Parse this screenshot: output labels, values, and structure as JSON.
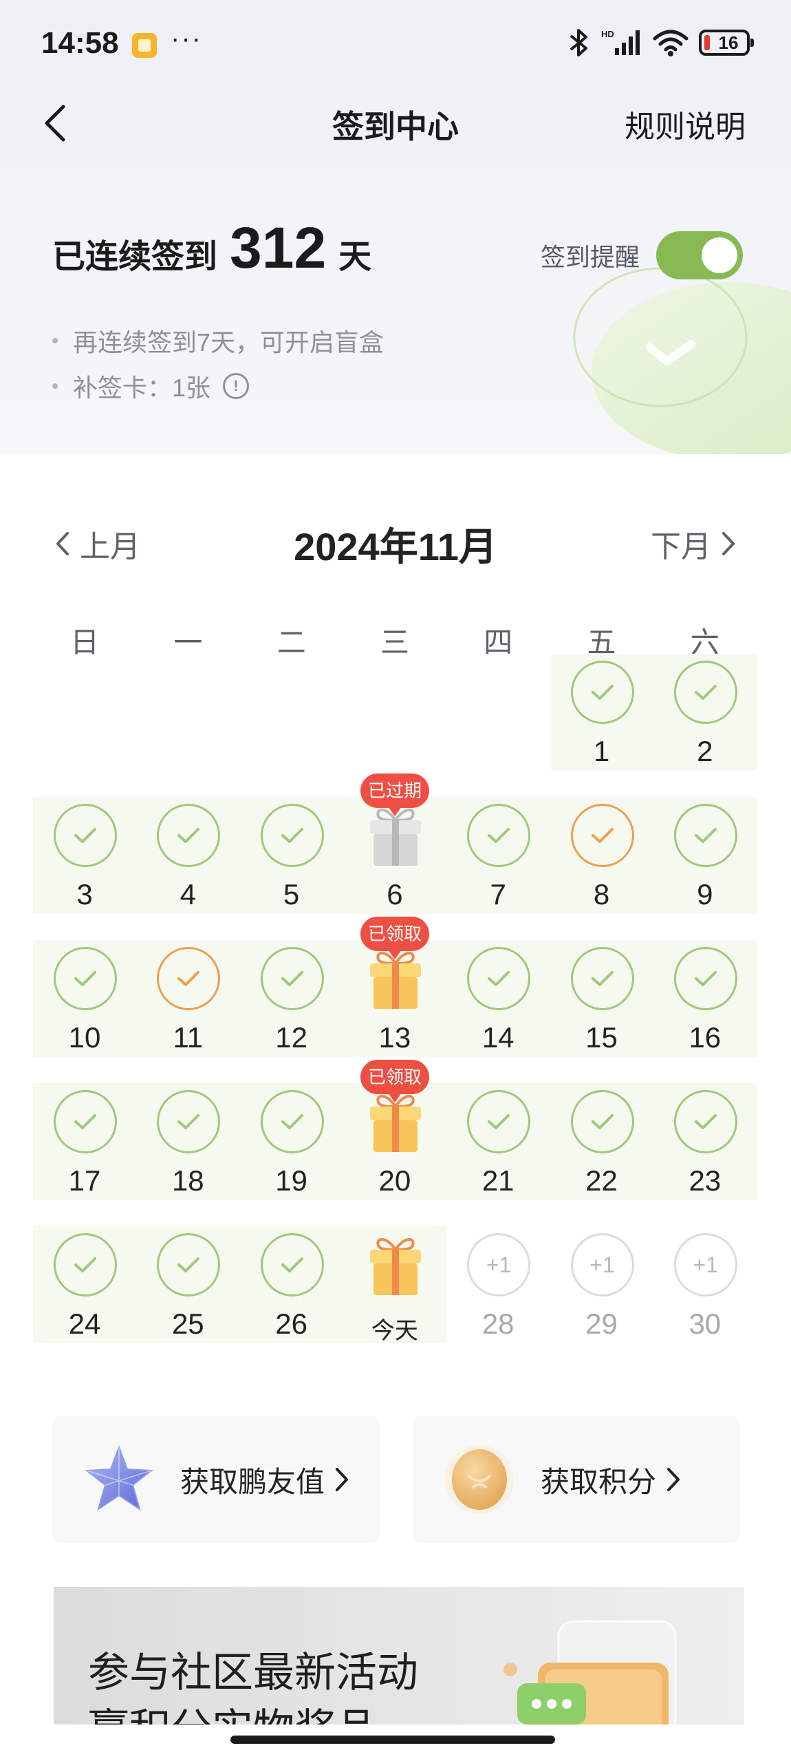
{
  "status_bar": {
    "time": "14:58",
    "more": "···",
    "network": "HD",
    "battery": "16"
  },
  "nav": {
    "title": "签到中心",
    "rules": "规则说明"
  },
  "streak": {
    "prefix": "已连续签到",
    "days": "312",
    "suffix": "天"
  },
  "reminder": {
    "label": "签到提醒",
    "enabled": true
  },
  "tips": [
    "再连续签到7天，可开启盲盒",
    "补签卡：1张"
  ],
  "calendar": {
    "prev": "上月",
    "next": "下月",
    "month_title": "2024年11月",
    "weekdays": [
      "日",
      "一",
      "二",
      "三",
      "四",
      "五",
      "六"
    ],
    "days": [
      {
        "label": "1",
        "status": "checked"
      },
      {
        "label": "2",
        "status": "checked"
      },
      {
        "label": "3",
        "status": "checked"
      },
      {
        "label": "4",
        "status": "checked"
      },
      {
        "label": "5",
        "status": "checked"
      },
      {
        "label": "6",
        "status": "gift-expired",
        "badge": "已过期"
      },
      {
        "label": "7",
        "status": "checked"
      },
      {
        "label": "8",
        "status": "makeup"
      },
      {
        "label": "9",
        "status": "checked"
      },
      {
        "label": "10",
        "status": "checked"
      },
      {
        "label": "11",
        "status": "makeup"
      },
      {
        "label": "12",
        "status": "checked"
      },
      {
        "label": "13",
        "status": "gift-claimed",
        "badge": "已领取"
      },
      {
        "label": "14",
        "status": "checked"
      },
      {
        "label": "15",
        "status": "checked"
      },
      {
        "label": "16",
        "status": "checked"
      },
      {
        "label": "17",
        "status": "checked"
      },
      {
        "label": "18",
        "status": "checked"
      },
      {
        "label": "19",
        "status": "checked"
      },
      {
        "label": "20",
        "status": "gift-claimed",
        "badge": "已领取"
      },
      {
        "label": "21",
        "status": "checked"
      },
      {
        "label": "22",
        "status": "checked"
      },
      {
        "label": "23",
        "status": "checked"
      },
      {
        "label": "24",
        "status": "checked"
      },
      {
        "label": "25",
        "status": "checked"
      },
      {
        "label": "26",
        "status": "checked"
      },
      {
        "label": "今天",
        "status": "gift-today"
      },
      {
        "label": "28",
        "status": "future",
        "reward": "+1"
      },
      {
        "label": "29",
        "status": "future",
        "reward": "+1"
      },
      {
        "label": "30",
        "status": "future",
        "reward": "+1"
      }
    ]
  },
  "cards": [
    {
      "label": "获取鹏友值",
      "icon": "star-crystal-icon"
    },
    {
      "label": "获取积分",
      "icon": "gold-coin-icon"
    }
  ],
  "banner": {
    "line1": "参与社区最新活动",
    "line2": "赢积分实物奖品"
  },
  "colors": {
    "check_green": "#9ec97a",
    "makeup_orange": "#eda04e",
    "toggle_green": "#87ba55",
    "badge_red": "#ef4f43",
    "row_bg": "#f5f9ef"
  }
}
